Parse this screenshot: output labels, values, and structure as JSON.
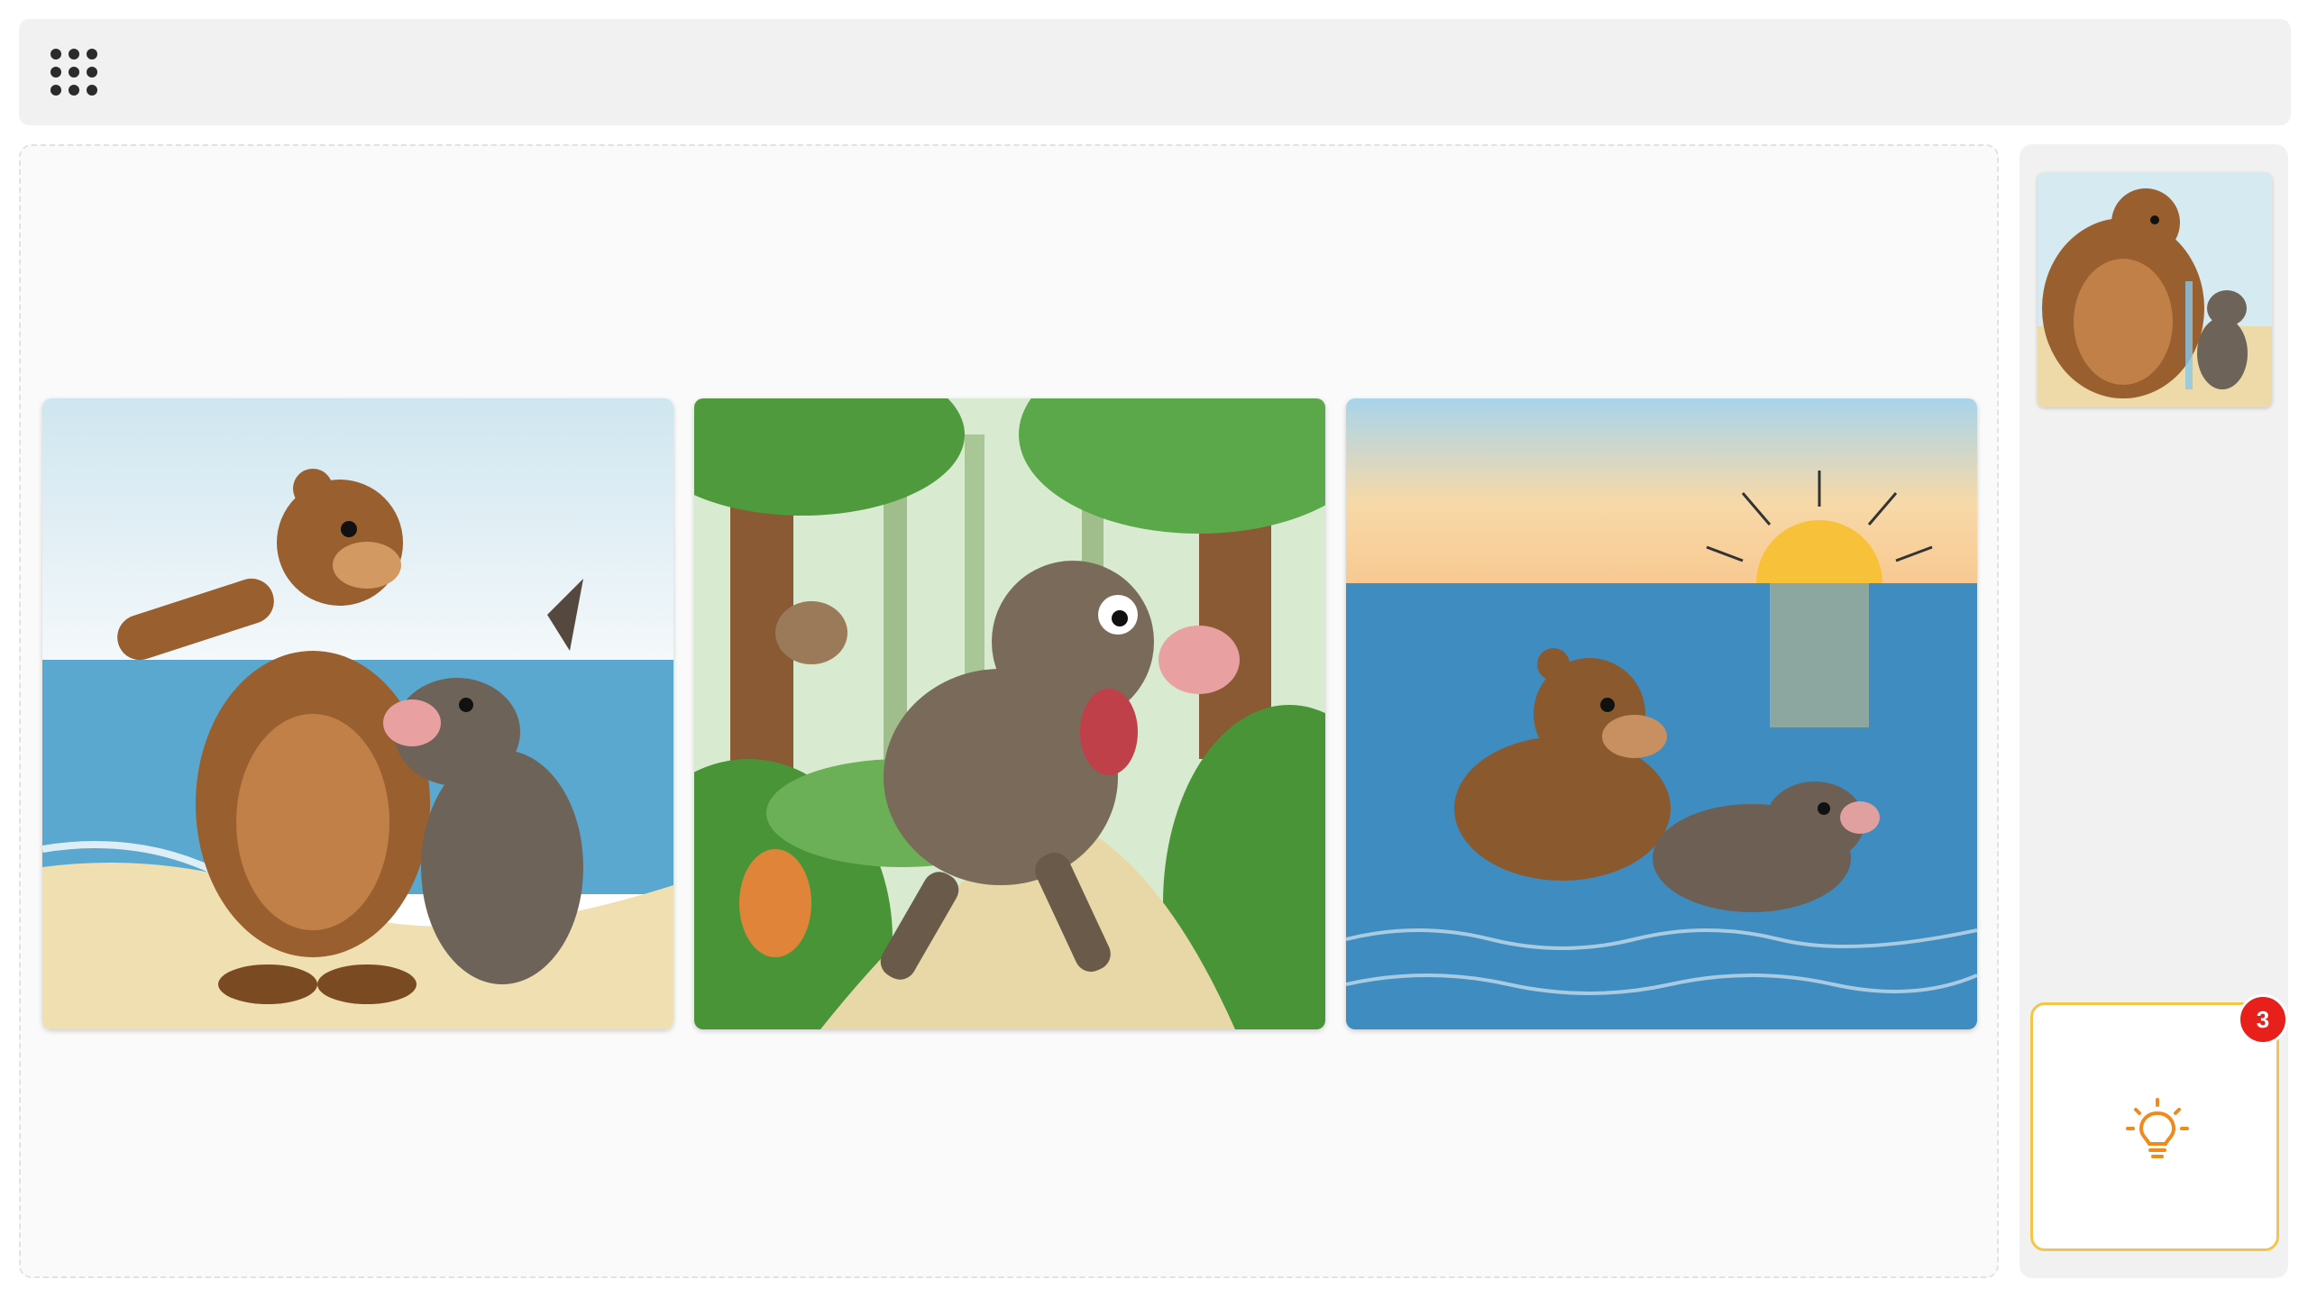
{
  "toolbar": {
    "apps_icon": "grid-dots-icon"
  },
  "story_panels": [
    {
      "scene": "bear-and-boar-on-beach"
    },
    {
      "scene": "boar-running-in-forest"
    },
    {
      "scene": "bear-and-boar-swimming-at-sunset"
    }
  ],
  "sidebar": {
    "thumbnail": {
      "scene": "bear-crying-with-boar"
    },
    "idea_button": {
      "icon": "lightbulb-icon",
      "badge_count": "3"
    }
  },
  "colors": {
    "accent": "#f5c54a",
    "badge": "#e8201c",
    "idea_icon": "#f08a1c"
  }
}
